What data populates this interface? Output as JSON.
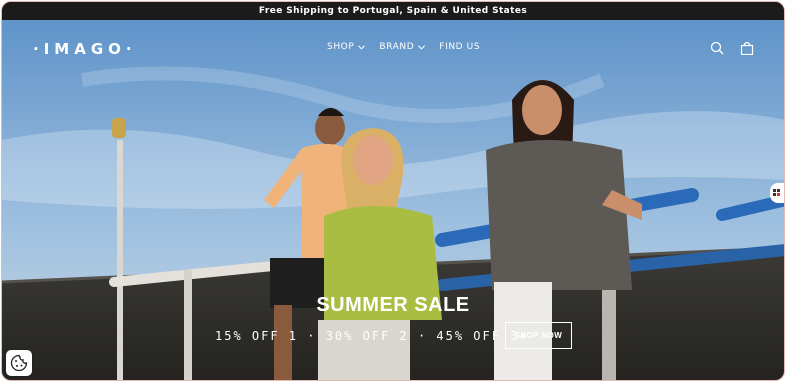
{
  "announcement": "Free Shipping to Portugal, Spain & United States",
  "header": {
    "logo": "·IMAGO·",
    "nav": [
      {
        "label": "SHOP",
        "has_dropdown": true
      },
      {
        "label": "BRAND",
        "has_dropdown": true
      },
      {
        "label": "FIND US",
        "has_dropdown": false
      }
    ],
    "icons": [
      "search-icon",
      "cart-icon"
    ]
  },
  "hero": {
    "title": "SUMMER SALE",
    "subtitle": "15% OFF 1 · 30% OFF 2 · 45% OFF 3+",
    "button_label": "SHOP NOW"
  },
  "widgets": {
    "cookie_icon": "cookie-icon",
    "side_icon": "grid-icon"
  },
  "colors": {
    "announcement_bg": "#1b1b1b",
    "sky": "#6a9fd1",
    "text": "#ffffff",
    "rail_blue": "#2a6ab8"
  }
}
